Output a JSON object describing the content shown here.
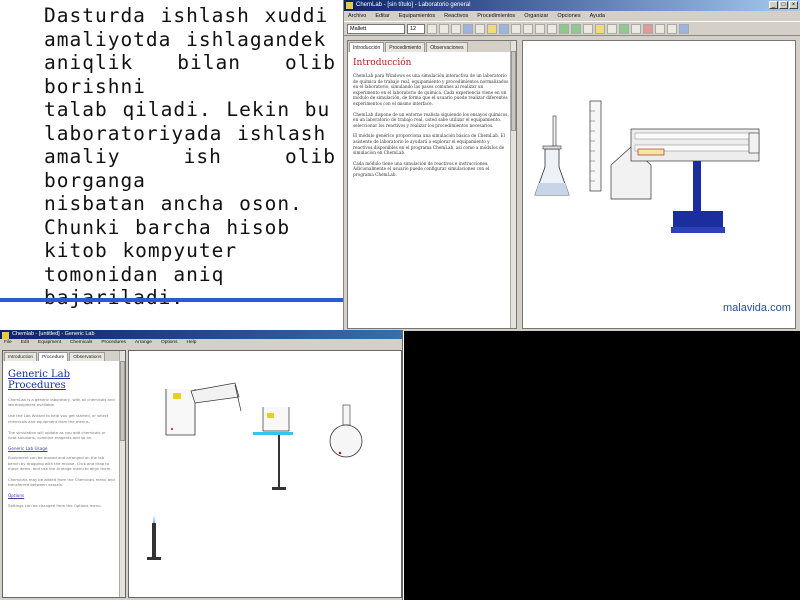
{
  "slide": {
    "lines": [
      "Dasturda ishlash xuddi",
      "amaliyotda ishlagandek",
      "aniqlik bilan olib borishni",
      "talab qiladi. Lekin bu",
      "laboratoriyada ishlash",
      "amaliy ish olib borganga",
      "nisbatan ancha oson.",
      "Chunki barcha hisob",
      "kitob kompyuter",
      "tomonidan aniq",
      "bajariladi."
    ]
  },
  "top_window": {
    "title": "ChemLab - [sin título] - Laboratorio general",
    "menu": [
      "Archivo",
      "Editar",
      "Equipamientos",
      "Reactivos",
      "Procedimientos",
      "Organizar",
      "Opciones",
      "Ayuda"
    ],
    "font_name": "Mallett",
    "font_size": "12",
    "tabs": [
      "Introducción",
      "Procedimiento",
      "Observaciones"
    ],
    "doc_heading": "Introducción",
    "paragraphs": [
      "ChemLab para Windows es una simulación interactiva de un laboratorio de química de trabajo real, equipamiento y procedimientos normalizados en el laboratorio, simulando las pasos comunes al realizar un experimento en el laboratorio de química. Cada experiencia viene en un módulo de simulación, de forma que el usuario puede realizar diferentes experimentos con el mismo interface.",
      "ChemLab dispone de un entorno realista siguiendo los ensayos químicos, en un laboratorio de trabajo real, usted sabe utilizar el equipamiento, seleccionar los reactivos y realizar los procedimientos necesarios.",
      "El módulo genérico proporciona una simulación básica de ChemLab. El asistente de laboratorio le ayudará a explorar el equipamiento y reactivos disponibles en el programa ChemLab, así como a módulos de simulación en ChemLab.",
      "Cada módulo tiene una simulación de reactivos e instrucciones. Adicionalmente el usuario puede configurar simulaciones con el programa ChemLab."
    ],
    "watermark": "malavida.com"
  },
  "bottom_window": {
    "title": "Chemlab - [untitled] - Generic Lab",
    "menu": [
      "File",
      "Edit",
      "Equipment",
      "Chemicals",
      "Procedures",
      "Arrange",
      "Options",
      "Help"
    ],
    "tabs": [
      "Introduction",
      "Procedure",
      "Observations"
    ],
    "doc_heading": "Generic Lab Procedures",
    "paragraphs": [
      "ChemLab is a generic laboratory, with all chemicals and lab equipment available.",
      "Use the Lab Wizard to help you get started, or select chemicals and equipment from the menus.",
      "The simulation will update as you add chemicals or heat solutions, combine reagents and so on."
    ],
    "sub_heading": "Generic Lab Usage",
    "paragraphs2": [
      "Equipment can be moved and arranged on the lab bench by dragging with the mouse. Click and drag to move items, and use the Arrange menu to align them.",
      "Chemicals may be added from the Chemicals menu and transferred between vessels."
    ],
    "sub_heading2": "Options",
    "paragraphs3": [
      "Settings can be changed from the Options menu."
    ]
  },
  "colors": {
    "title_blue": "#0a246a",
    "heading_red": "#b02020",
    "heading_blue": "#1a2ea0",
    "stand_blue": "#1a2e9e",
    "watermark_blue": "#2a4d9a"
  }
}
